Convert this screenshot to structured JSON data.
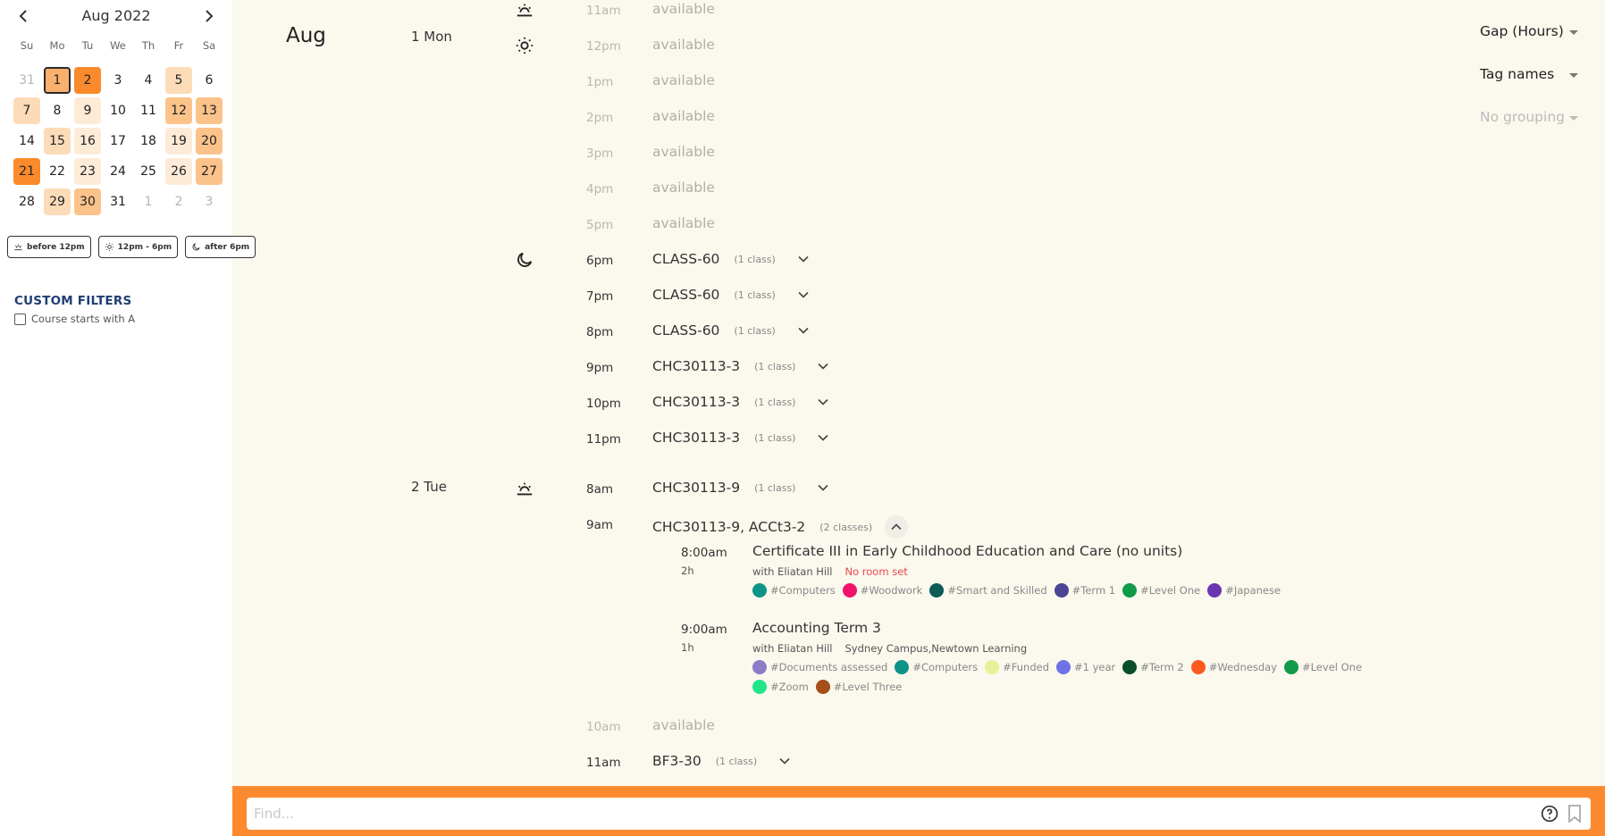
{
  "calendar": {
    "title": "Aug 2022",
    "prev_label": "‹",
    "next_label": "›",
    "weekdays": [
      "Su",
      "Mo",
      "Tu",
      "We",
      "Th",
      "Fr",
      "Sa"
    ],
    "days": [
      {
        "n": "31",
        "muted": true,
        "level": 0
      },
      {
        "n": "1",
        "level": 3,
        "selected": true
      },
      {
        "n": "2",
        "level": 4
      },
      {
        "n": "3",
        "level": 0
      },
      {
        "n": "4",
        "level": 0
      },
      {
        "n": "5",
        "level": 2
      },
      {
        "n": "6",
        "level": 0
      },
      {
        "n": "7",
        "level": 2
      },
      {
        "n": "8",
        "level": 0
      },
      {
        "n": "9",
        "level": 1
      },
      {
        "n": "10",
        "level": 0
      },
      {
        "n": "11",
        "level": 0
      },
      {
        "n": "12",
        "level": 3
      },
      {
        "n": "13",
        "level": 3
      },
      {
        "n": "14",
        "level": 0
      },
      {
        "n": "15",
        "level": 2
      },
      {
        "n": "16",
        "level": 1
      },
      {
        "n": "17",
        "level": 0
      },
      {
        "n": "18",
        "level": 0
      },
      {
        "n": "19",
        "level": 1
      },
      {
        "n": "20",
        "level": 3
      },
      {
        "n": "21",
        "level": 4
      },
      {
        "n": "22",
        "level": 0
      },
      {
        "n": "23",
        "level": 1
      },
      {
        "n": "24",
        "level": 0
      },
      {
        "n": "25",
        "level": 0
      },
      {
        "n": "26",
        "level": 1
      },
      {
        "n": "27",
        "level": 3
      },
      {
        "n": "28",
        "level": 0
      },
      {
        "n": "29",
        "level": 2
      },
      {
        "n": "30",
        "level": 3
      },
      {
        "n": "31",
        "level": 0
      },
      {
        "n": "1",
        "muted": true,
        "level": 0
      },
      {
        "n": "2",
        "muted": true,
        "level": 0
      },
      {
        "n": "3",
        "muted": true,
        "level": 0
      }
    ]
  },
  "time_filters": {
    "morning": "before 12pm",
    "afternoon": "12pm - 6pm",
    "evening": "after 6pm"
  },
  "custom_filters": {
    "title": "CUSTOM FILTERS",
    "items": [
      {
        "label": "Course starts with A",
        "checked": false
      }
    ]
  },
  "schedule": {
    "month": "Aug",
    "days": [
      {
        "label": "1 Mon"
      },
      {
        "label": "2 Tue"
      }
    ],
    "mon_slots": [
      {
        "time": "11am",
        "label": "available",
        "available": true
      },
      {
        "time": "12pm",
        "label": "available",
        "available": true
      },
      {
        "time": "1pm",
        "label": "available",
        "available": true
      },
      {
        "time": "2pm",
        "label": "available",
        "available": true
      },
      {
        "time": "3pm",
        "label": "available",
        "available": true
      },
      {
        "time": "4pm",
        "label": "available",
        "available": true
      },
      {
        "time": "5pm",
        "label": "available",
        "available": true
      },
      {
        "time": "6pm",
        "label": "CLASS-60",
        "count": "(1 class)"
      },
      {
        "time": "7pm",
        "label": "CLASS-60",
        "count": "(1 class)"
      },
      {
        "time": "8pm",
        "label": "CLASS-60",
        "count": "(1 class)"
      },
      {
        "time": "9pm",
        "label": "CHC30113-3",
        "count": "(1 class)"
      },
      {
        "time": "10pm",
        "label": "CHC30113-3",
        "count": "(1 class)"
      },
      {
        "time": "11pm",
        "label": "CHC30113-3",
        "count": "(1 class)"
      }
    ],
    "tue_slots": [
      {
        "time": "8am",
        "label": "CHC30113-9",
        "count": "(1 class)"
      },
      {
        "time": "9am",
        "label": "CHC30113-9, ACCt3-2",
        "count": "(2 classes)",
        "expanded": true
      },
      {
        "time": "10am",
        "label": "available",
        "available": true
      },
      {
        "time": "11am",
        "label": "BF3-30",
        "count": "(1 class)"
      }
    ],
    "expanded_classes": [
      {
        "start": "8:00am",
        "duration": "2h",
        "name": "Certificate III in Early Childhood Education and Care (no units)",
        "trainer": "with Eliatan Hill",
        "room": "No room set",
        "room_missing": true,
        "tags": [
          {
            "label": "#Computers",
            "color": "#0d9488"
          },
          {
            "label": "#Woodwork",
            "color": "#f0136b"
          },
          {
            "label": "#Smart and Skilled",
            "color": "#0b5c55"
          },
          {
            "label": "#Term 1",
            "color": "#4a4695"
          },
          {
            "label": "#Level One",
            "color": "#109a4a"
          },
          {
            "label": "#Japanese",
            "color": "#6b35b0"
          }
        ]
      },
      {
        "start": "9:00am",
        "duration": "1h",
        "name": "Accounting Term 3",
        "trainer": "with Eliatan Hill",
        "room": "Sydney Campus,Newtown Learning",
        "room_missing": false,
        "tags": [
          {
            "label": "#Documents assessed",
            "color": "#8b7cc8"
          },
          {
            "label": "#Computers",
            "color": "#0d9488"
          },
          {
            "label": "#Funded",
            "color": "#e6f29a"
          },
          {
            "label": "#1 year",
            "color": "#6f72e6"
          },
          {
            "label": "#Term 2",
            "color": "#0b4f2a"
          },
          {
            "label": "#Wednesday",
            "color": "#fb5a1e"
          },
          {
            "label": "#Level One",
            "color": "#109a4a"
          },
          {
            "label": "#Zoom",
            "color": "#22e58a"
          },
          {
            "label": "#Level Three",
            "color": "#a54e17"
          }
        ]
      }
    ]
  },
  "options": {
    "gap": "Gap (Hours)",
    "tags": "Tag names",
    "grouping": "No grouping"
  },
  "find": {
    "placeholder": "Find...",
    "value": ""
  },
  "colors": {
    "accent": "#fd8a2e",
    "background": "#fbf8ee",
    "filter_title": "#1f3f73",
    "warning": "#e34b4b"
  }
}
